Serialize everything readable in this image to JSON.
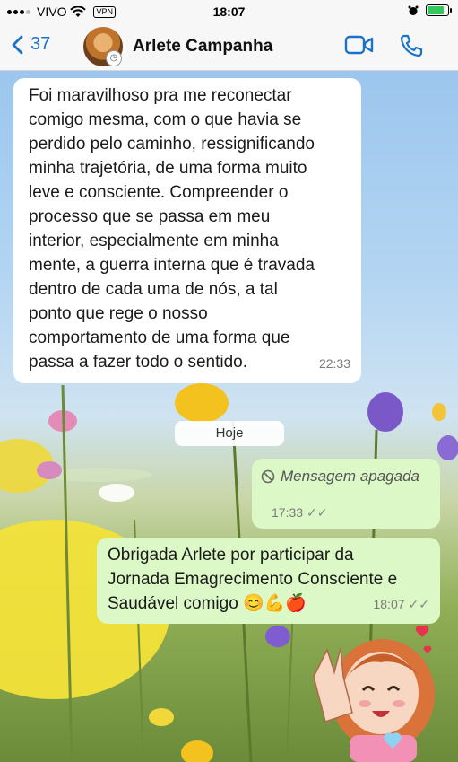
{
  "status_bar": {
    "carrier": "VIVO",
    "vpn": "VPN",
    "time": "18:07"
  },
  "header": {
    "back_count": "37",
    "contact_name": "Arlete Campanha",
    "icons": [
      "chevron-left-icon",
      "video-call-icon",
      "phone-icon"
    ]
  },
  "messages": {
    "incoming_text": "Foi maravilhoso pra me reconectar comigo mesma, com o que havia se perdido pelo caminho, ressignificando minha trajetória, de uma forma muito leve e consciente. Compreender o processo que se passa em meu interior, especialmente em minha mente, a guerra interna que é travada dentro de cada uma de nós, a tal ponto que rege o nosso comportamento de uma forma que passa a fazer todo o sentido.",
    "incoming_lines": [
      "Foi maravilhoso pra me reconectar",
      "comigo mesma, com o que havia se",
      "perdido pelo caminho, ressignificando",
      "minha trajetória, de uma forma muito",
      "leve e consciente. Compreender o",
      "processo que se passa em meu",
      "interior, especialmente em minha",
      "mente, a guerra interna que é travada",
      "dentro de cada uma de nós, a tal",
      "ponto que rege o nosso",
      "comportamento de uma forma que",
      "passa a fazer todo o sentido."
    ],
    "incoming_time": "22:33",
    "day_divider": "Hoje",
    "deleted_text": "Mensagem apagada",
    "deleted_time": "17:33",
    "outgoing_lines": [
      "Obrigada Arlete por participar da",
      "Jornada Emagrecimento Consciente e",
      "Saudável comigo 😊💪🍎"
    ],
    "outgoing_time": "18:07"
  },
  "colors": {
    "accent": "#1a73c7",
    "incoming_bubble": "#ffffff",
    "outgoing_bubble": "#dcf8c6"
  }
}
